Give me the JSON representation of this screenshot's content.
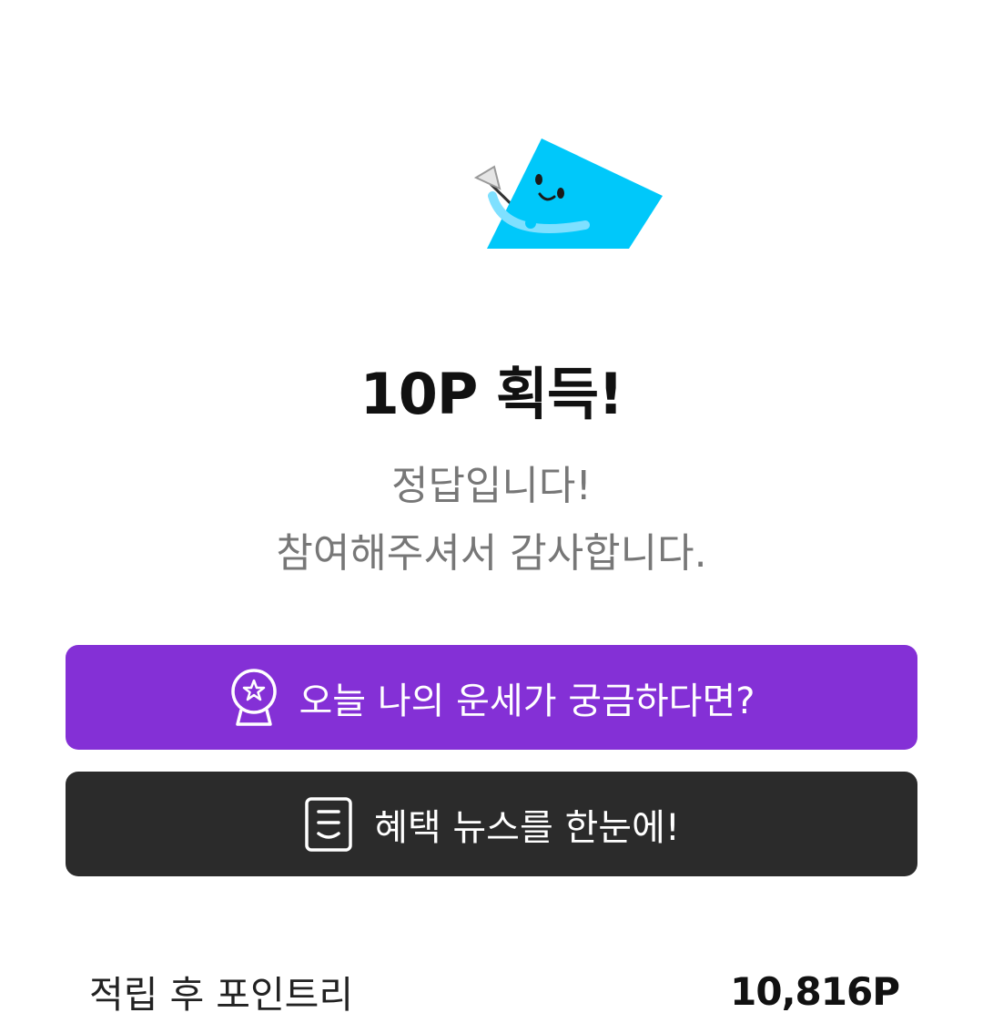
{
  "result": {
    "title": "10P 획득!",
    "message_line1": "정답입니다!",
    "message_line2": "참여해주셔서 감사합니다."
  },
  "buttons": {
    "fortune_label": "오늘 나의 운세가 궁금하다면?",
    "fortune_icon": "crystal-ball-icon",
    "news_label": "혜택 뉴스를 한눈에!",
    "news_icon": "document-icon"
  },
  "points": {
    "label": "적립 후 포인트리",
    "value": "10,816P"
  },
  "colors": {
    "fortune_button": "#8430D6",
    "news_button": "#2B2B2B",
    "mascot": "#00C8FA",
    "title": "#111111",
    "subtitle": "#777777"
  }
}
